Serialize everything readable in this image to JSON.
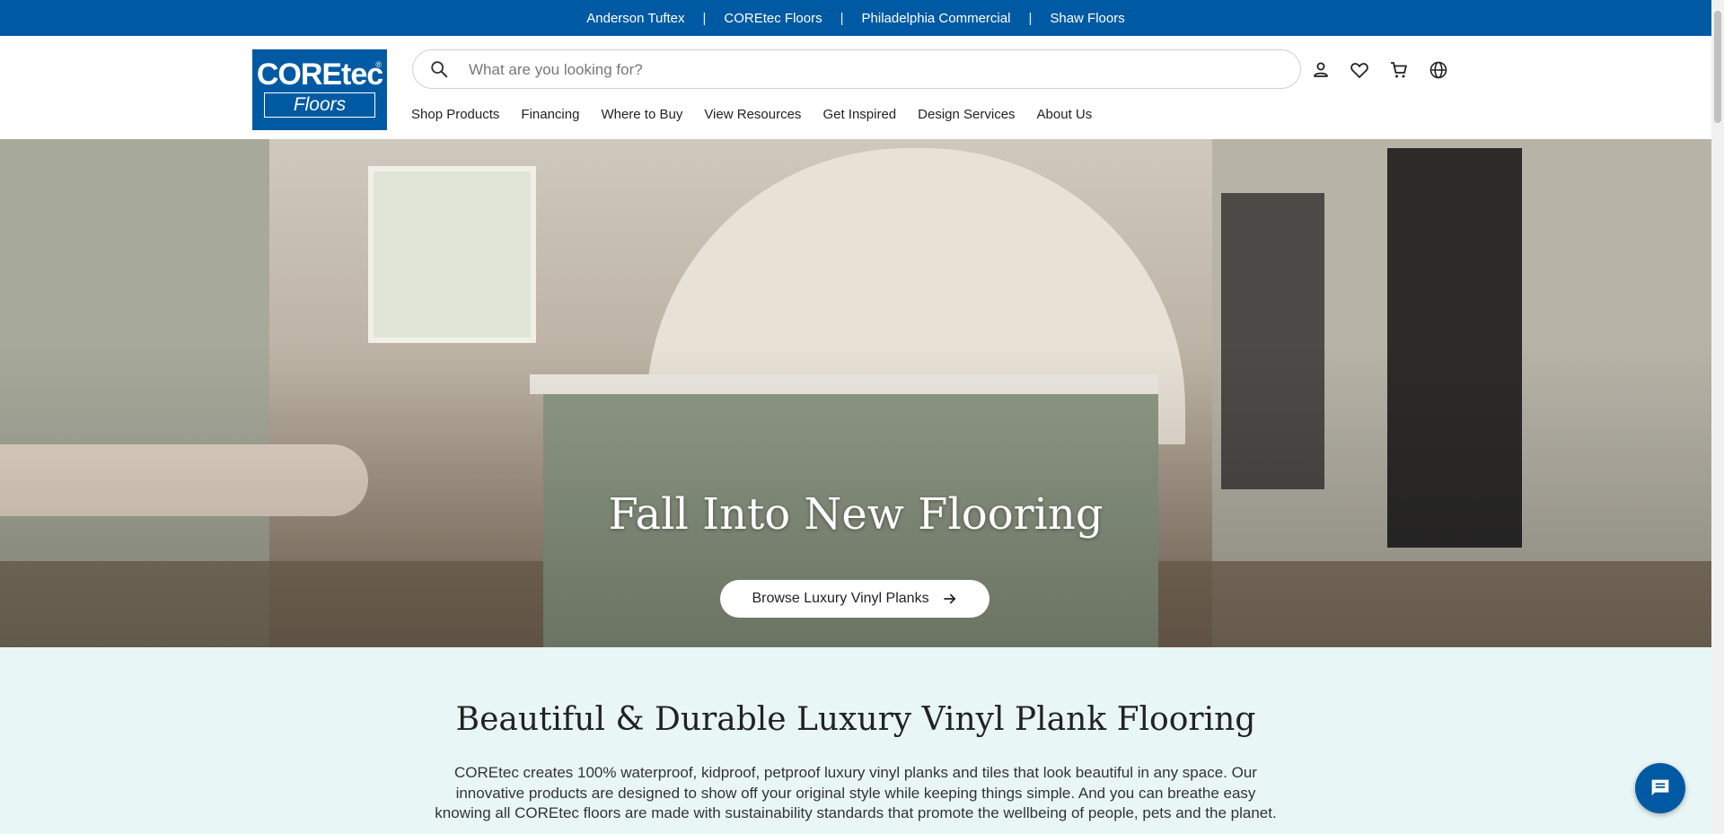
{
  "topbar": {
    "links": [
      "Anderson Tuftex",
      "COREtec Floors",
      "Philadelphia Commercial",
      "Shaw Floors"
    ],
    "separator": "|"
  },
  "logo": {
    "line1": "COREtec",
    "line2": "Floors",
    "mark": "®"
  },
  "search": {
    "placeholder": "What are you looking for?",
    "value": "",
    "icon": "search-icon"
  },
  "header_icons": [
    "account-icon",
    "heart-icon",
    "cart-icon",
    "globe-icon"
  ],
  "nav": {
    "items": [
      "Shop Products",
      "Financing",
      "Where to Buy",
      "View Resources",
      "Get Inspired",
      "Design Services",
      "About Us"
    ]
  },
  "hero": {
    "title": "Fall Into New Flooring",
    "cta_label": "Browse Luxury Vinyl Planks",
    "cta_icon": "arrow-right-icon"
  },
  "intro": {
    "heading": "Beautiful & Durable Luxury Vinyl Plank Flooring",
    "body": "COREtec creates 100% waterproof, kidproof, petproof luxury vinyl planks and tiles that look beautiful in any space. Our innovative products are designed to show off your original style while keeping things simple. And you can breathe easy knowing all COREtec floors are made with sustainability standards that promote the wellbeing of people, pets and the planet."
  },
  "chat": {
    "icon": "chat-icon"
  },
  "colors": {
    "brand": "#005aa3",
    "intro_bg": "#e9f6f6",
    "white": "#ffffff"
  }
}
